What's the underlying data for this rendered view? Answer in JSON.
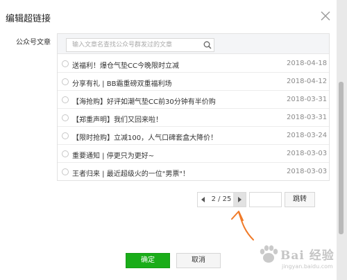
{
  "dialog": {
    "title": "编辑超链接",
    "close_icon": "close-icon"
  },
  "field_label": "公众号文章",
  "search": {
    "placeholder": "输入文章名查找公众号群发过的文章",
    "icon": "search-icon"
  },
  "articles": [
    {
      "title": "送福利！爆仓气垫CC今晚限时立减",
      "date": "2018-04-18"
    },
    {
      "title": "分享有礼 | BB霜重磅双重福利场",
      "date": "2018-04-12"
    },
    {
      "title": "【海抢购】好评如潮气垫CC前30分钟有半价购",
      "date": "2018-03-31"
    },
    {
      "title": "【郑重声明】我们又回来啦！",
      "date": "2018-03-31"
    },
    {
      "title": "【限时抢购】立减100，人气口碑套盒大降价！",
      "date": "2018-03-24"
    },
    {
      "title": "重要通知 | 停更只为更好~",
      "date": "2018-03-03"
    },
    {
      "title": "王者归来 | 最近超级火的一位\"男票\"！",
      "date": "2018-03-03"
    }
  ],
  "pagination": {
    "current_display": "2 / 25",
    "jump_value": "",
    "jump_label": "跳转"
  },
  "footer": {
    "ok_label": "确定",
    "cancel_label": "取消"
  },
  "watermark": {
    "text": "Bai 经验",
    "url": "jingyan.baidu.com"
  },
  "colors": {
    "primary_green": "#1aad19",
    "annotation_orange": "#f07a28"
  }
}
